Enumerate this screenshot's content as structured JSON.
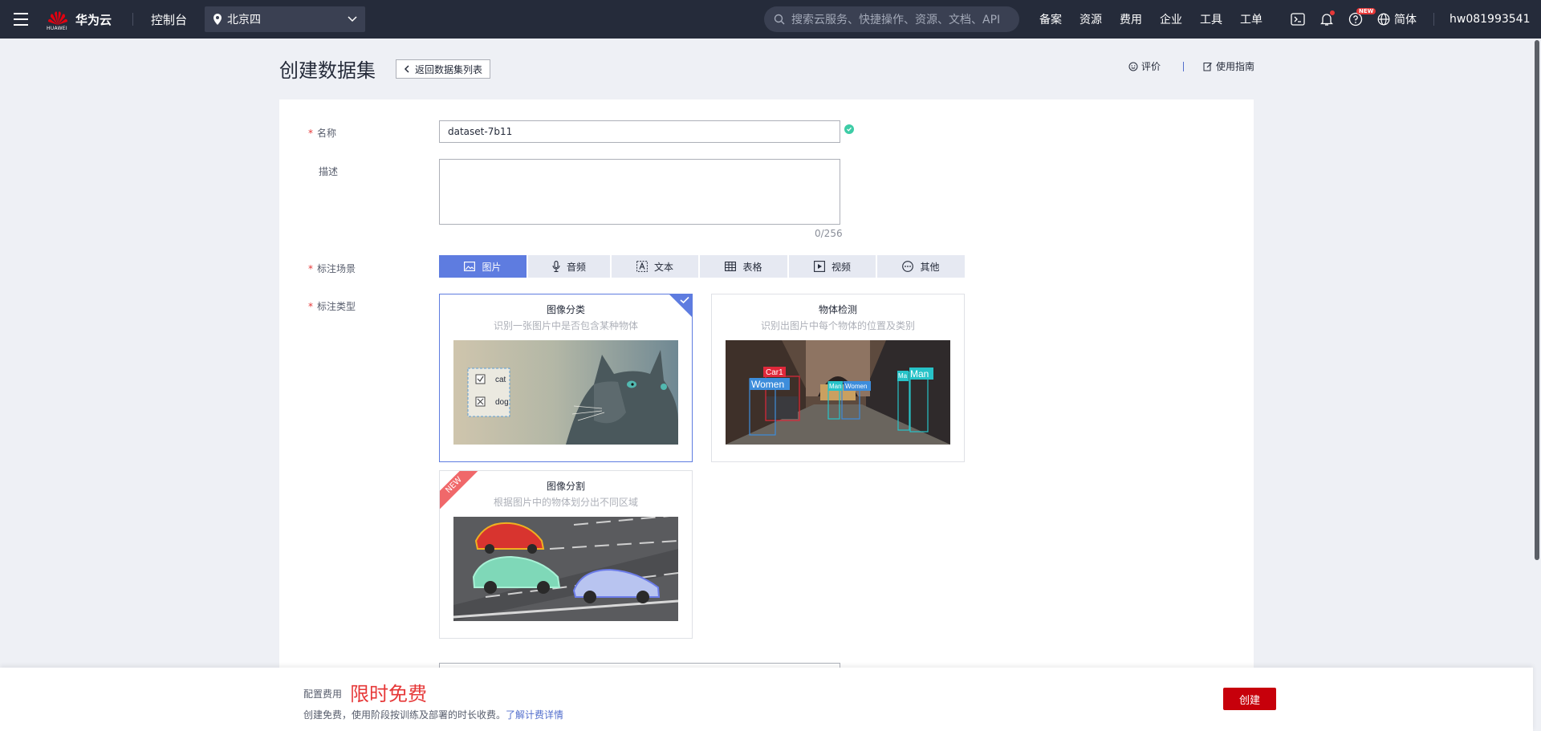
{
  "topbar": {
    "logo_text": "华为云",
    "logo_sub": "HUAWEI",
    "console": "控制台",
    "region": "北京四",
    "search_placeholder": "搜索云服务、快捷操作、资源、文档、API",
    "links": [
      "备案",
      "资源",
      "费用",
      "企业",
      "工具",
      "工单"
    ],
    "new_badge": "NEW",
    "lang": "简体",
    "user": "hw081993541"
  },
  "header": {
    "title": "创建数据集",
    "back": "返回数据集列表",
    "rate": "评价",
    "guide": "使用指南"
  },
  "form": {
    "name_label": "名称",
    "name_value": "dataset-7b11",
    "desc_label": "描述",
    "desc_counter": "0/256",
    "scene_label": "标注场景",
    "scenes": [
      {
        "label": "图片",
        "icon": "image-icon",
        "active": true
      },
      {
        "label": "音频",
        "icon": "microphone-icon",
        "active": false
      },
      {
        "label": "文本",
        "icon": "text-icon",
        "active": false
      },
      {
        "label": "表格",
        "icon": "table-icon",
        "active": false
      },
      {
        "label": "视频",
        "icon": "video-icon",
        "active": false
      },
      {
        "label": "其他",
        "icon": "more-icon",
        "active": false
      }
    ],
    "type_label": "标注类型",
    "types": [
      {
        "title": "图像分类",
        "desc": "识别一张图片中是否包含某种物体",
        "selected": true,
        "tags": [
          "cat",
          "dog"
        ]
      },
      {
        "title": "物体检测",
        "desc": "识别出图片中每个物体的位置及类别",
        "selected": false,
        "boxes": [
          "Car1",
          "Women",
          "Man",
          "Women",
          "Ma",
          "Man"
        ]
      },
      {
        "title": "图像分割",
        "desc": "根据图片中的物体划分出不同区域",
        "selected": false,
        "ribbon": "NEW"
      }
    ]
  },
  "footer": {
    "fee_label": "配置费用",
    "fee_value": "限时免费",
    "fee_desc": "创建免费，使用阶段按训练及部署的时长收费。",
    "fee_link": "了解计费详情",
    "create": "创建"
  },
  "colors": {
    "accent": "#5e7ce0",
    "brand_red": "#c7000b",
    "topbar": "#252b3a",
    "success": "#3dcca6"
  }
}
